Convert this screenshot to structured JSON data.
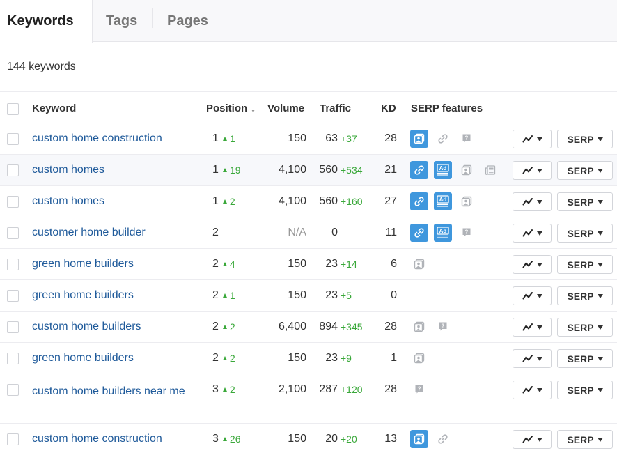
{
  "tabs": [
    {
      "label": "Keywords",
      "active": true
    },
    {
      "label": "Tags",
      "active": false
    },
    {
      "label": "Pages",
      "active": false
    }
  ],
  "keyword_count": "144 keywords",
  "columns": {
    "keyword": "Keyword",
    "position": "Position",
    "position_sort": "↓",
    "volume": "Volume",
    "traffic": "Traffic",
    "kd": "KD",
    "serp_features": "SERP features"
  },
  "colors": {
    "accent": "#3f97dd",
    "link": "#1f5a9a",
    "positive": "#3aa83a"
  },
  "row_buttons": {
    "chart_icon": "trend-line-icon",
    "serp_label": "SERP"
  },
  "rows": [
    {
      "keyword": "custom home construction",
      "position": "1",
      "pos_change": "1",
      "volume": "150",
      "traffic": "63",
      "traffic_change": "+37",
      "kd": "28",
      "serp": [
        {
          "icon": "image-pack-icon",
          "active": true
        },
        {
          "icon": "link-icon",
          "active": false
        },
        {
          "icon": "question-icon",
          "active": false
        }
      ]
    },
    {
      "keyword": "custom homes",
      "position": "1",
      "pos_change": "19",
      "volume": "4,100",
      "traffic": "560",
      "traffic_change": "+534",
      "kd": "21",
      "serp": [
        {
          "icon": "link-icon",
          "active": true
        },
        {
          "icon": "ad-icon",
          "active": true
        },
        {
          "icon": "image-pack-icon",
          "active": false
        },
        {
          "icon": "news-icon",
          "active": false
        }
      ]
    },
    {
      "keyword": "custom homes",
      "position": "1",
      "pos_change": "2",
      "volume": "4,100",
      "traffic": "560",
      "traffic_change": "+160",
      "kd": "27",
      "serp": [
        {
          "icon": "link-icon",
          "active": true
        },
        {
          "icon": "ad-icon",
          "active": true
        },
        {
          "icon": "image-pack-icon",
          "active": false
        }
      ]
    },
    {
      "keyword": "customer home builder",
      "position": "2",
      "pos_change": "",
      "volume": "N/A",
      "traffic": "0",
      "traffic_change": "",
      "kd": "11",
      "serp": [
        {
          "icon": "link-icon",
          "active": true
        },
        {
          "icon": "ad-icon",
          "active": true
        },
        {
          "icon": "question-icon",
          "active": false
        }
      ]
    },
    {
      "keyword": "green home builders",
      "position": "2",
      "pos_change": "4",
      "volume": "150",
      "traffic": "23",
      "traffic_change": "+14",
      "kd": "6",
      "serp": [
        {
          "icon": "image-pack-icon",
          "active": false
        }
      ]
    },
    {
      "keyword": "green home builders",
      "position": "2",
      "pos_change": "1",
      "volume": "150",
      "traffic": "23",
      "traffic_change": "+5",
      "kd": "0",
      "serp": []
    },
    {
      "keyword": "custom home builders",
      "position": "2",
      "pos_change": "2",
      "volume": "6,400",
      "traffic": "894",
      "traffic_change": "+345",
      "kd": "28",
      "serp": [
        {
          "icon": "image-pack-icon",
          "active": false
        },
        {
          "icon": "question-icon",
          "active": false
        }
      ]
    },
    {
      "keyword": "green home builders",
      "position": "2",
      "pos_change": "2",
      "volume": "150",
      "traffic": "23",
      "traffic_change": "+9",
      "kd": "1",
      "serp": [
        {
          "icon": "image-pack-icon",
          "active": false
        }
      ]
    },
    {
      "keyword": "custom home builders near me",
      "position": "3",
      "pos_change": "2",
      "volume": "2,100",
      "traffic": "287",
      "traffic_change": "+120",
      "kd": "28",
      "serp": [
        {
          "icon": "question-icon",
          "active": false
        }
      ]
    },
    {
      "keyword": "custom home construction",
      "position": "3",
      "pos_change": "26",
      "volume": "150",
      "traffic": "20",
      "traffic_change": "+20",
      "kd": "13",
      "serp": [
        {
          "icon": "image-pack-icon",
          "active": true
        },
        {
          "icon": "link-icon",
          "active": false
        }
      ]
    }
  ]
}
